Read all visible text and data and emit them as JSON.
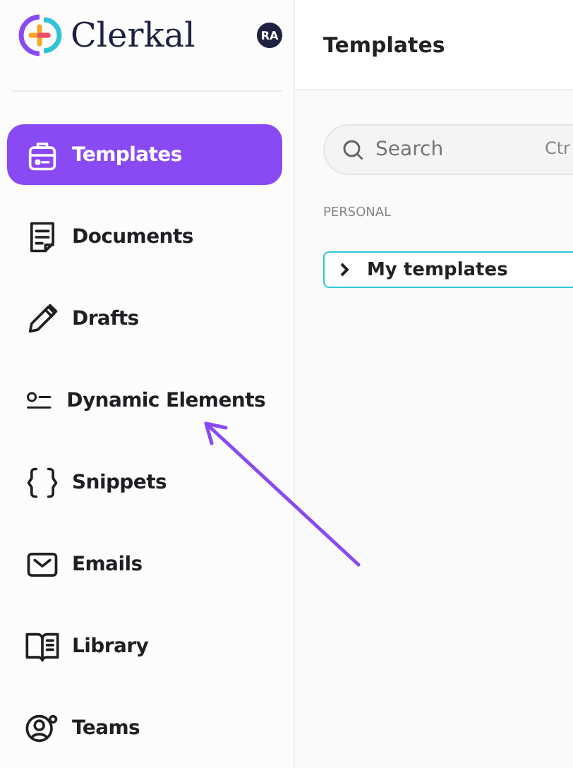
{
  "sidebar": {
    "logo": "Clerkal",
    "avatar": "RA",
    "items": [
      {
        "label": "Templates",
        "kind": "templates",
        "selected": true
      },
      {
        "label": "Documents",
        "kind": "documents",
        "selected": false
      },
      {
        "label": "Drafts",
        "kind": "drafts",
        "selected": false
      },
      {
        "label": "Dynamic Elements",
        "kind": "dynamic",
        "selected": false
      },
      {
        "label": "Snippets",
        "kind": "snippets",
        "selected": false
      },
      {
        "label": "Emails",
        "kind": "emails",
        "selected": false
      },
      {
        "label": "Library",
        "kind": "library",
        "selected": false
      },
      {
        "label": "Teams",
        "kind": "teams",
        "selected": false
      }
    ]
  },
  "main": {
    "title": "Templates",
    "search": {
      "placeholder": "Search",
      "shortcut": "Ctr"
    },
    "section": "PERSONAL",
    "tree": [
      {
        "label": "My templates",
        "expanded": false
      }
    ]
  }
}
